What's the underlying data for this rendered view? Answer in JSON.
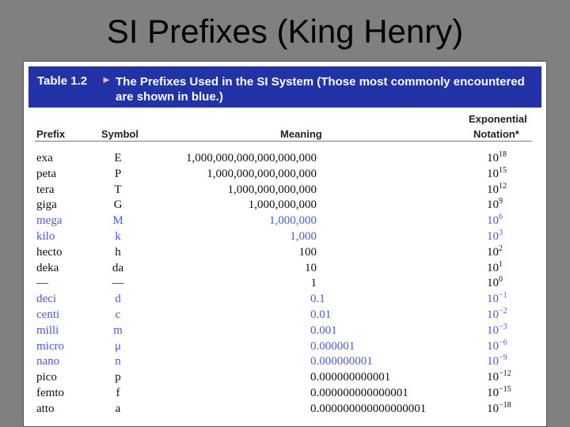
{
  "slide": {
    "title": "SI Prefixes (King Henry)"
  },
  "table": {
    "label": "Table 1.2",
    "arrow": "►",
    "caption": "The Prefixes Used in the SI System (Those most commonly encountered are shown in blue.)",
    "headers": {
      "prefix": "Prefix",
      "symbol": "Symbol",
      "meaning": "Meaning",
      "exp_line1": "Exponential",
      "exp_line2": "Notation*"
    },
    "colors": {
      "banner": "#2233a8",
      "blue_text": "#4a5ad6",
      "black_text": "#111111"
    },
    "rows": [
      {
        "prefix": "exa",
        "symbol": "E",
        "meaning": "1,000,000,000,000,000,000",
        "base": "10",
        "exponent": "18",
        "color": "black"
      },
      {
        "prefix": "peta",
        "symbol": "P",
        "meaning": "1,000,000,000,000,000",
        "base": "10",
        "exponent": "15",
        "color": "black"
      },
      {
        "prefix": "tera",
        "symbol": "T",
        "meaning": "1,000,000,000,000",
        "base": "10",
        "exponent": "12",
        "color": "black"
      },
      {
        "prefix": "giga",
        "symbol": "G",
        "meaning": "1,000,000,000",
        "base": "10",
        "exponent": "9",
        "color": "black"
      },
      {
        "prefix": "mega",
        "symbol": "M",
        "meaning": "1,000,000",
        "base": "10",
        "exponent": "6",
        "color": "blue"
      },
      {
        "prefix": "kilo",
        "symbol": "k",
        "meaning": "1,000",
        "base": "10",
        "exponent": "3",
        "color": "blue"
      },
      {
        "prefix": "hecto",
        "symbol": "h",
        "meaning": "100",
        "base": "10",
        "exponent": "2",
        "color": "black"
      },
      {
        "prefix": "deka",
        "symbol": "da",
        "meaning": "10",
        "base": "10",
        "exponent": "1",
        "color": "black"
      },
      {
        "prefix": "—",
        "symbol": "—",
        "meaning": "1",
        "base": "10",
        "exponent": "0",
        "color": "black"
      },
      {
        "prefix": "deci",
        "symbol": "d",
        "meaning": "0.1",
        "base": "10",
        "exponent": "−1",
        "color": "blue"
      },
      {
        "prefix": "centi",
        "symbol": "c",
        "meaning": "0.01",
        "base": "10",
        "exponent": "−2",
        "color": "blue"
      },
      {
        "prefix": "milli",
        "symbol": "m",
        "meaning": "0.001",
        "base": "10",
        "exponent": "−3",
        "color": "blue"
      },
      {
        "prefix": "micro",
        "symbol": "μ",
        "meaning": "0.000001",
        "base": "10",
        "exponent": "−6",
        "color": "blue"
      },
      {
        "prefix": "nano",
        "symbol": "n",
        "meaning": "0.000000001",
        "base": "10",
        "exponent": "−9",
        "color": "blue"
      },
      {
        "prefix": "pico",
        "symbol": "p",
        "meaning": "0.000000000001",
        "base": "10",
        "exponent": "−12",
        "color": "black"
      },
      {
        "prefix": "femto",
        "symbol": "f",
        "meaning": "0.000000000000001",
        "base": "10",
        "exponent": "−15",
        "color": "black"
      },
      {
        "prefix": "atto",
        "symbol": "a",
        "meaning": "0.000000000000000001",
        "base": "10",
        "exponent": "−18",
        "color": "black"
      }
    ]
  }
}
